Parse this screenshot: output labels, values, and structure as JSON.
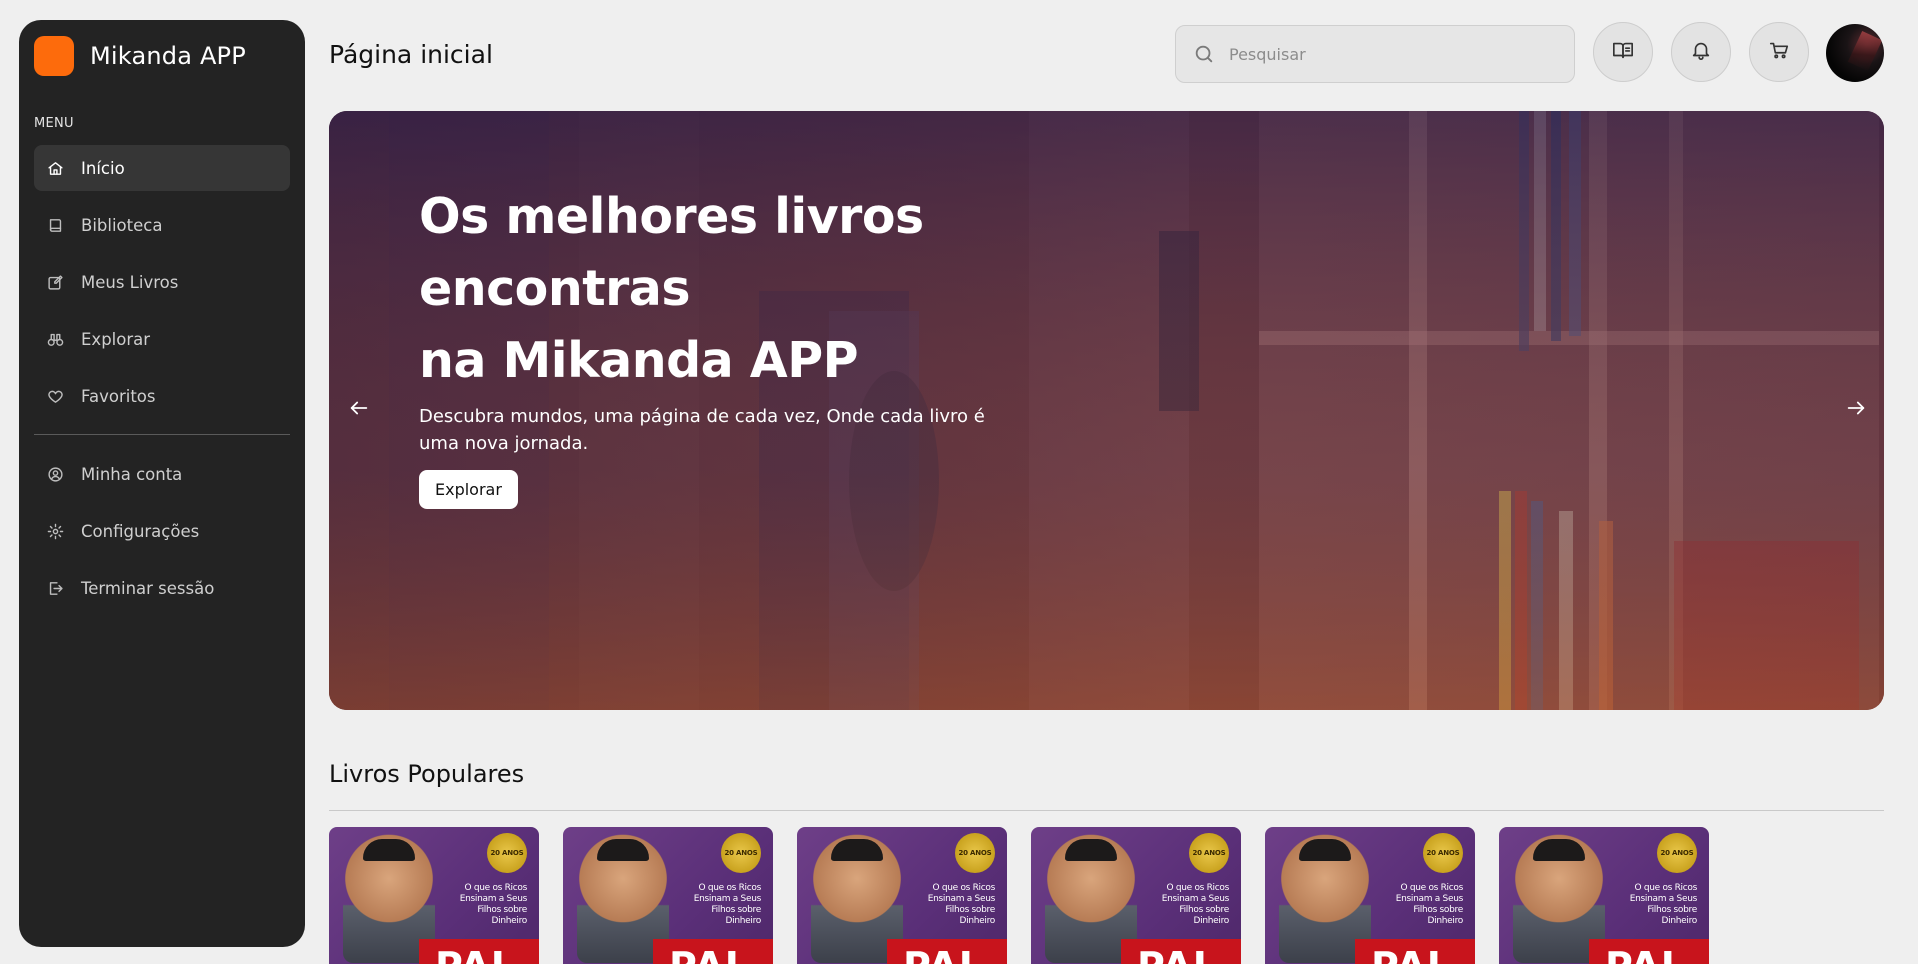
{
  "brand": {
    "name": "Mikanda APP",
    "logo_color": "#fd6b0c"
  },
  "sidebar": {
    "menu_label": "MENU",
    "items": [
      {
        "label": "Início",
        "icon": "home-icon",
        "active": true
      },
      {
        "label": "Biblioteca",
        "icon": "book-icon",
        "active": false
      },
      {
        "label": "Meus Livros",
        "icon": "edit-icon",
        "active": false
      },
      {
        "label": "Explorar",
        "icon": "binoculars-icon",
        "active": false
      },
      {
        "label": "Favoritos",
        "icon": "heart-icon",
        "active": false
      }
    ],
    "secondary_items": [
      {
        "label": "Minha conta",
        "icon": "user-circle-icon"
      },
      {
        "label": "Configurações",
        "icon": "gear-icon"
      },
      {
        "label": "Terminar sessão",
        "icon": "logout-icon"
      }
    ]
  },
  "header": {
    "title": "Página inicial",
    "search_placeholder": "Pesquisar",
    "search_value": "",
    "actions": [
      "open-book-icon",
      "bell-icon",
      "cart-icon"
    ]
  },
  "hero": {
    "title_line1": "Os melhores livros encontras",
    "title_line2": "na Mikanda APP",
    "subtitle": "Descubra mundos, uma página de cada vez, Onde cada livro é uma nova jornada.",
    "button": "Explorar"
  },
  "popular": {
    "title": "Livros Populares",
    "books": [
      {
        "seal": "20 ANOS",
        "tagline": "O que os Ricos Ensinam a Seus Filhos sobre Dinheiro",
        "title": "PAI"
      },
      {
        "seal": "20 ANOS",
        "tagline": "O que os Ricos Ensinam a Seus Filhos sobre Dinheiro",
        "title": "PAI"
      },
      {
        "seal": "20 ANOS",
        "tagline": "O que os Ricos Ensinam a Seus Filhos sobre Dinheiro",
        "title": "PAI"
      },
      {
        "seal": "20 ANOS",
        "tagline": "O que os Ricos Ensinam a Seus Filhos sobre Dinheiro",
        "title": "PAI"
      },
      {
        "seal": "20 ANOS",
        "tagline": "O que os Ricos Ensinam a Seus Filhos sobre Dinheiro",
        "title": "PAI"
      },
      {
        "seal": "20 ANOS",
        "tagline": "O que os Ricos Ensinam a Seus Filhos sobre Dinheiro",
        "title": "PAI"
      }
    ]
  }
}
